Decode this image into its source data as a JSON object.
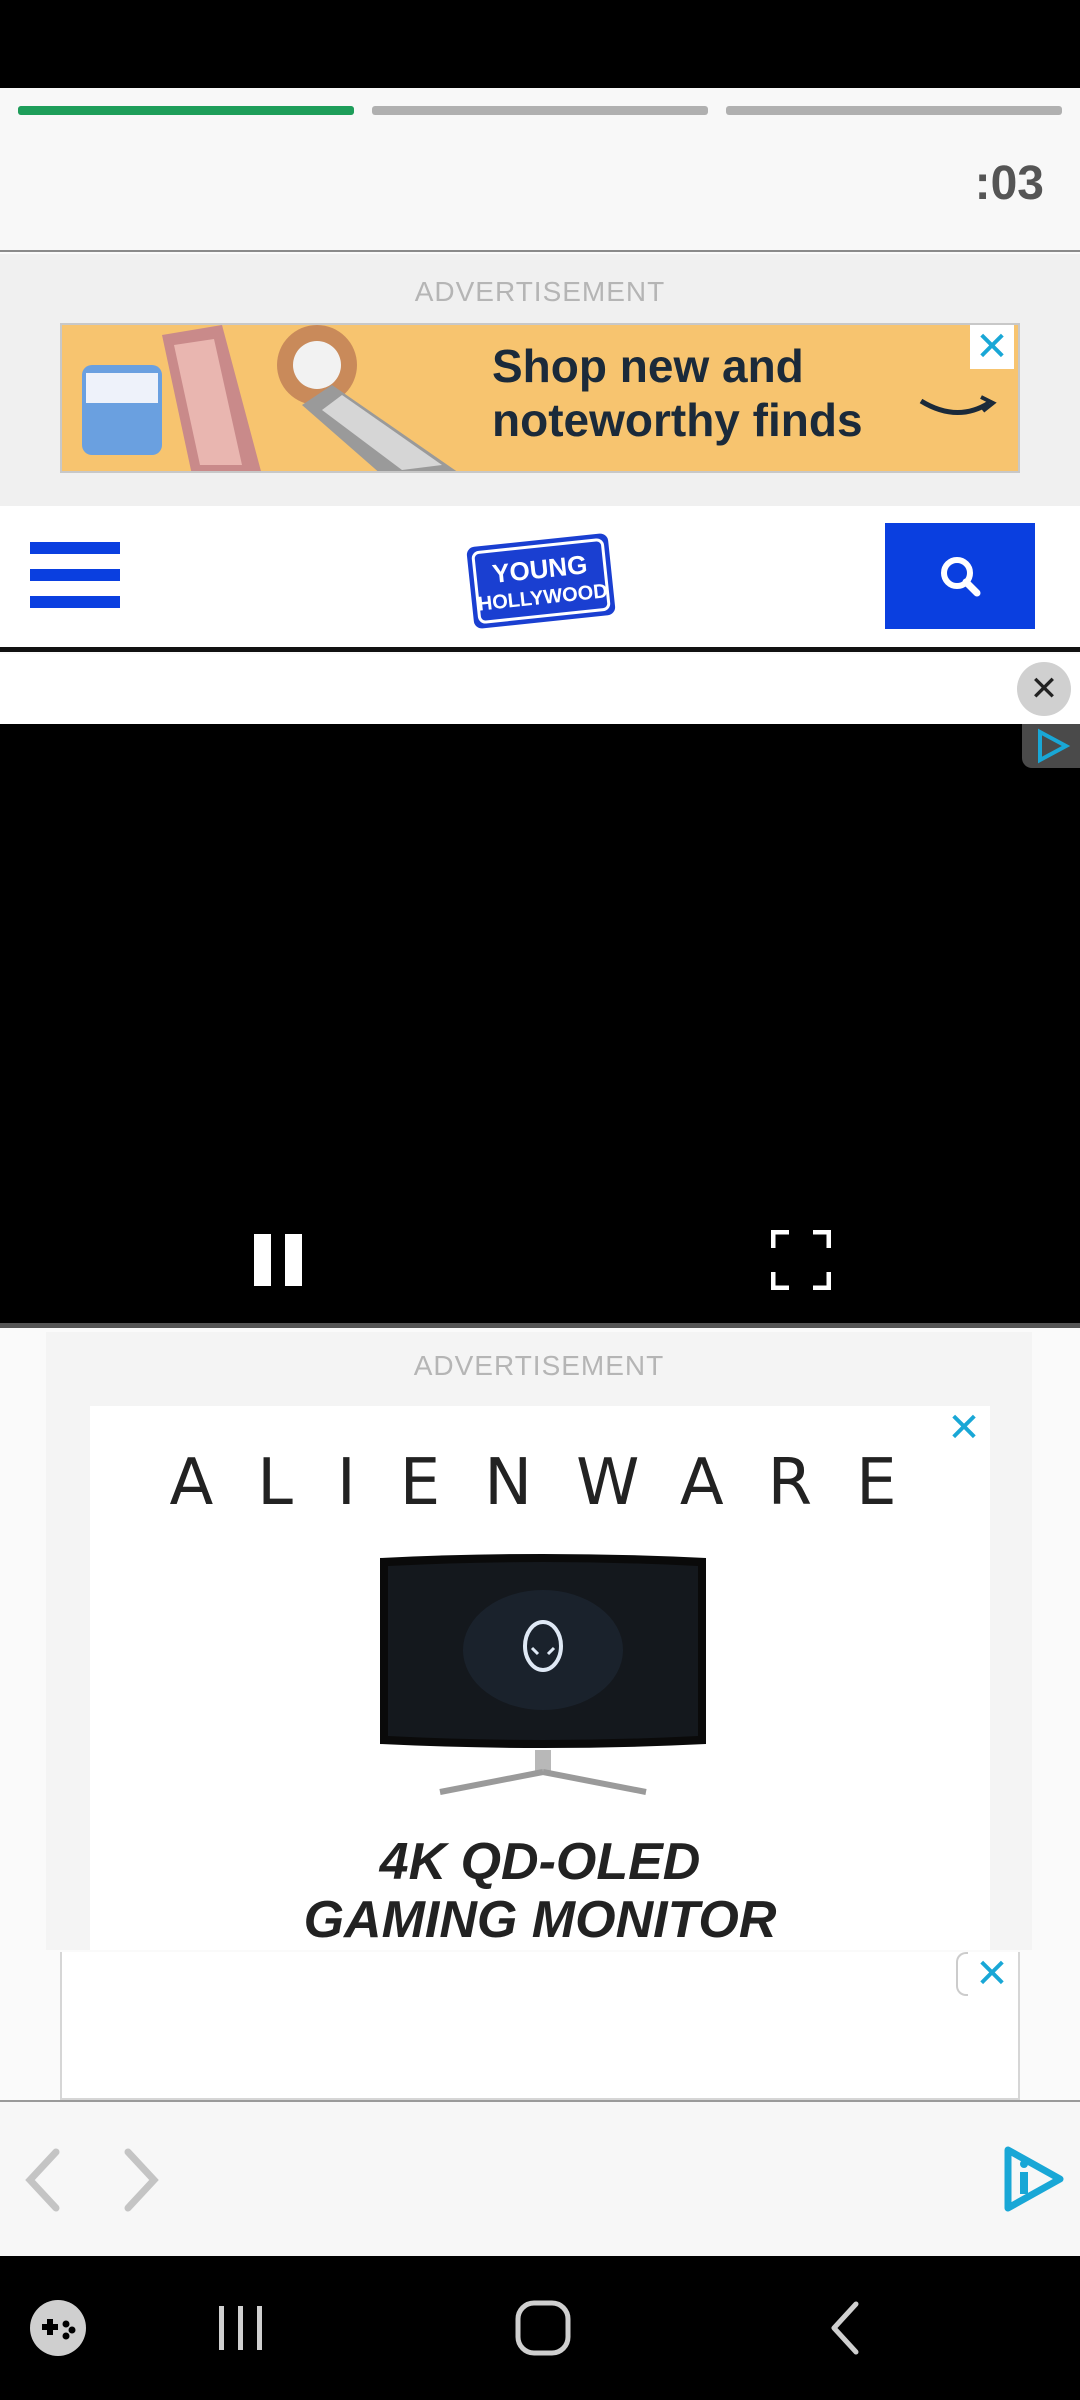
{
  "story": {
    "timer": ":03",
    "progress": [
      1.0,
      0.0,
      0.0
    ],
    "progress_active_color": "#1e9e5a",
    "progress_inactive_color": "#b0b0b0"
  },
  "ad_top": {
    "label": "ADVERTISEMENT",
    "line1": "Shop new and",
    "line2": "noteworthy finds",
    "close_icon": "close-icon"
  },
  "nav": {
    "menu_icon": "hamburger-menu-icon",
    "logo_line1": "YOUNG",
    "logo_line2": "HOLLYWOOD",
    "search_icon": "search-icon",
    "brand_color": "#0a3fe0"
  },
  "video": {
    "close_icon": "close-icon",
    "pause_icon": "pause-icon",
    "fullscreen_icon": "fullscreen-icon",
    "adchoices_icon": "adchoices-icon"
  },
  "ad_middle": {
    "label": "ADVERTISEMENT",
    "brand": "ALIENWARE",
    "line1": "4K QD-OLED",
    "line2": "GAMING MONITOR",
    "close_icon": "close-icon"
  },
  "ad_bottom": {
    "close_icon": "close-icon"
  },
  "bottom_nav": {
    "prev_icon": "chevron-left-icon",
    "next_icon": "chevron-right-icon",
    "brand_icon": "play-info-icon"
  },
  "system_nav": {
    "game_icon": "game-launcher-icon",
    "recents_icon": "recents-icon",
    "home_icon": "home-icon",
    "back_icon": "back-icon"
  }
}
